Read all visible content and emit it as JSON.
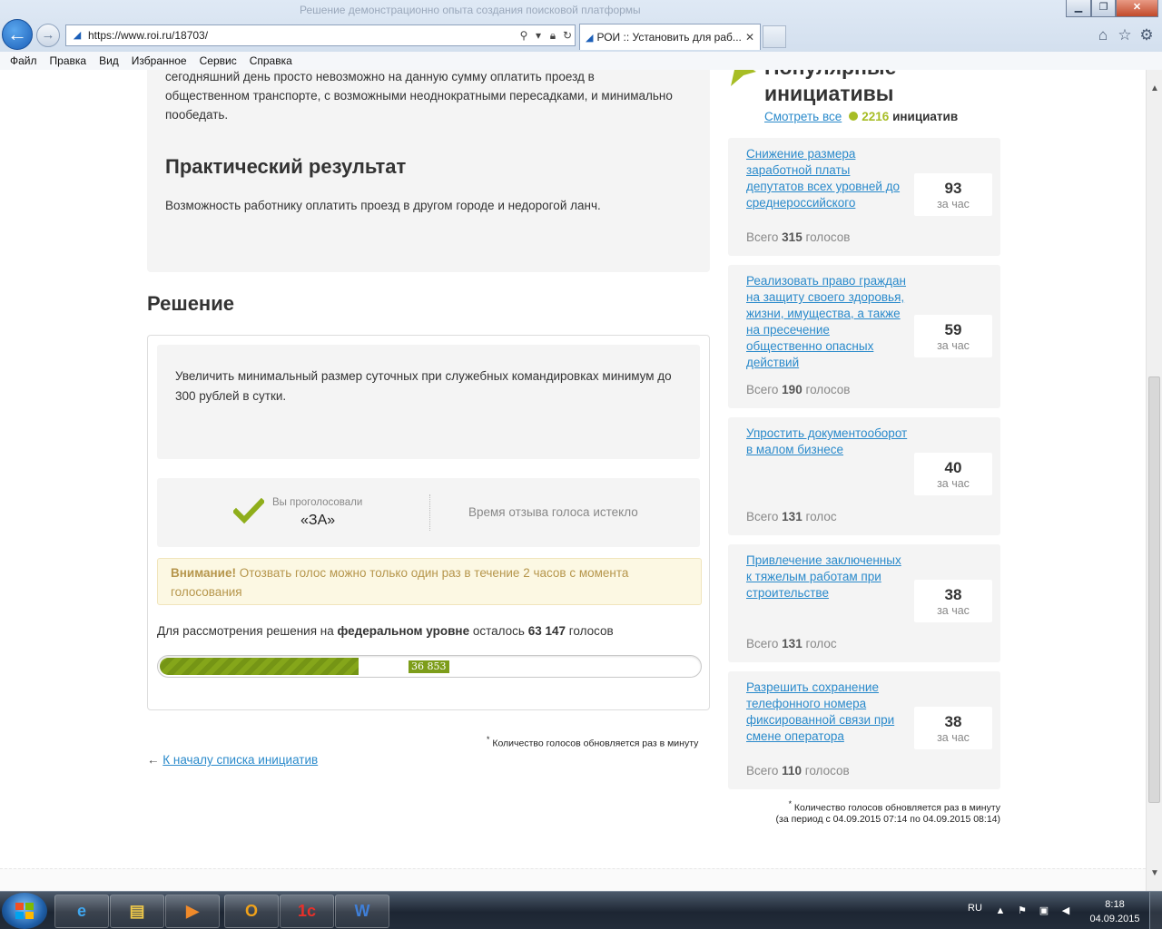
{
  "browser": {
    "window_title": "Решение демонстрационно опыта создания поисковой платформы",
    "url": "https://www.roi.ru/18703/",
    "tab_title": "РОИ :: Установить для раб...",
    "menu": [
      "Файл",
      "Правка",
      "Вид",
      "Избранное",
      "Сервис",
      "Справка"
    ]
  },
  "content": {
    "intro_text": "сегодняшний день просто невозможно на данную сумму оплатить проезд в общественном транспорте, с возможными неоднократными пересадками, и минимально пообедать.",
    "practical_heading": "Практический результат",
    "practical_text": "Возможность работнику оплатить проезд в другом городе и недорогой ланч.",
    "decision_heading": "Решение",
    "decision_text": "Увеличить минимальный размер суточных при служебных командировках минимум до 300 рублей в сутки.",
    "vote": {
      "voted_label": "Вы проголосовали",
      "voted_value": "«ЗА»",
      "expired_text": "Время отзыва голоса истекло"
    },
    "warning": {
      "title": "Внимание!",
      "text": " Отозвать голос можно только один раз в течение 2 часов с момента голосования"
    },
    "federal": {
      "prefix": "Для рассмотрения решения на ",
      "level": "федеральном уровне",
      "middle": " осталось ",
      "remaining": "63 147",
      "suffix": " голосов"
    },
    "progress": {
      "label": "36 853",
      "votes": 36853,
      "target": 100000,
      "fill_color": "#85a61a"
    },
    "note": "Количество голосов обновляется раз в минуту",
    "back_arrow": "←",
    "back_link": "К началу списка инициатив"
  },
  "sidebar": {
    "title": "Популярные инициативы",
    "see_all": "Смотреть все",
    "count": "2216",
    "count_word": "инициатив",
    "accent_color": "#a7bd25",
    "per_hour_label": "за час",
    "total_prefix": "Всего",
    "initiatives": [
      {
        "title": "Снижение размера заработной платы депутатов всех уровней до среднероссийского",
        "per_hour": "93",
        "total": "315",
        "total_word": "голосов"
      },
      {
        "title": "Реализовать право граждан на защиту своего здоровья, жизни, имущества, а также на пресечение общественно опасных действий",
        "per_hour": "59",
        "total": "190",
        "total_word": "голосов"
      },
      {
        "title": "Упростить документооборот в малом бизнесе",
        "per_hour": "40",
        "total": "131",
        "total_word": "голос"
      },
      {
        "title": "Привлечение заключенных к тяжелым работам при строительстве",
        "per_hour": "38",
        "total": "131",
        "total_word": "голос"
      },
      {
        "title": "Разрешить сохранение телефонного номера фиксированной связи при смене оператора",
        "per_hour": "38",
        "total": "110",
        "total_word": "голосов"
      }
    ],
    "note_line1": "Количество голосов обновляется раз в минуту",
    "note_line2": "(за период с 04.09.2015 07:14 по 04.09.2015 08:14)"
  },
  "taskbar": {
    "language": "RU",
    "time": "8:18",
    "date": "04.09.2015",
    "apps": [
      "internet-explorer",
      "file-explorer",
      "media-player",
      "outlook",
      "1c",
      "word"
    ]
  }
}
